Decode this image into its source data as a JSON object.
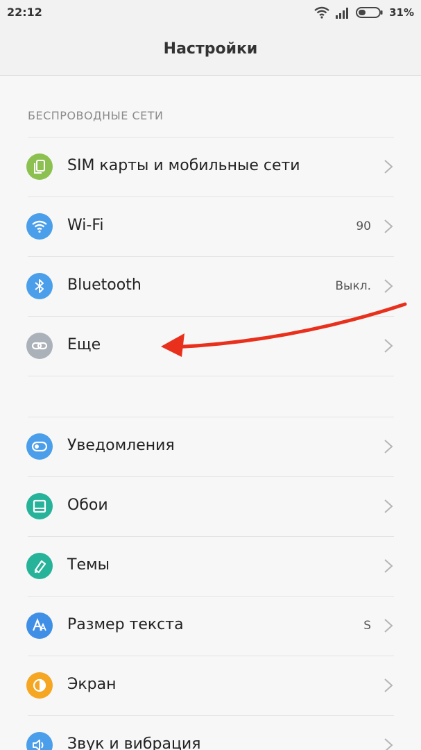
{
  "status_bar": {
    "time": "22:12",
    "battery": "31%",
    "icons": [
      "wifi-icon",
      "signal-icon",
      "battery-icon"
    ]
  },
  "header": {
    "title": "Настройки"
  },
  "sections": {
    "wireless_label": "БЕСПРОВОДНЫЕ СЕТИ"
  },
  "items": {
    "sim": {
      "label": "SIM карты и мобильные сети",
      "icon": "sim-cards-icon",
      "color": "#8cc152"
    },
    "wifi": {
      "label": "Wi-Fi",
      "value": "90",
      "icon": "wifi-icon",
      "color": "#4a9eea"
    },
    "bluetooth": {
      "label": "Bluetooth",
      "value": "Выкл.",
      "icon": "bluetooth-icon",
      "color": "#4a9eea"
    },
    "more": {
      "label": "Еще",
      "icon": "link-icon",
      "color": "#aab1b8"
    },
    "notifications": {
      "label": "Уведомления",
      "icon": "toggle-icon",
      "color": "#4a9eea"
    },
    "wallpaper": {
      "label": "Обои",
      "icon": "wallpaper-icon",
      "color": "#26b39a"
    },
    "themes": {
      "label": "Темы",
      "icon": "brush-icon",
      "color": "#26b39a"
    },
    "text_size": {
      "label": "Размер текста",
      "value": "S",
      "icon": "font-size-icon",
      "color": "#3f8fe6"
    },
    "display": {
      "label": "Экран",
      "icon": "brightness-icon",
      "color": "#f5a623"
    },
    "sound": {
      "label": "Звук и вибрация",
      "icon": "speaker-icon",
      "color": "#4a9eea"
    }
  },
  "annotation": {
    "arrow_color": "#e8301c"
  }
}
